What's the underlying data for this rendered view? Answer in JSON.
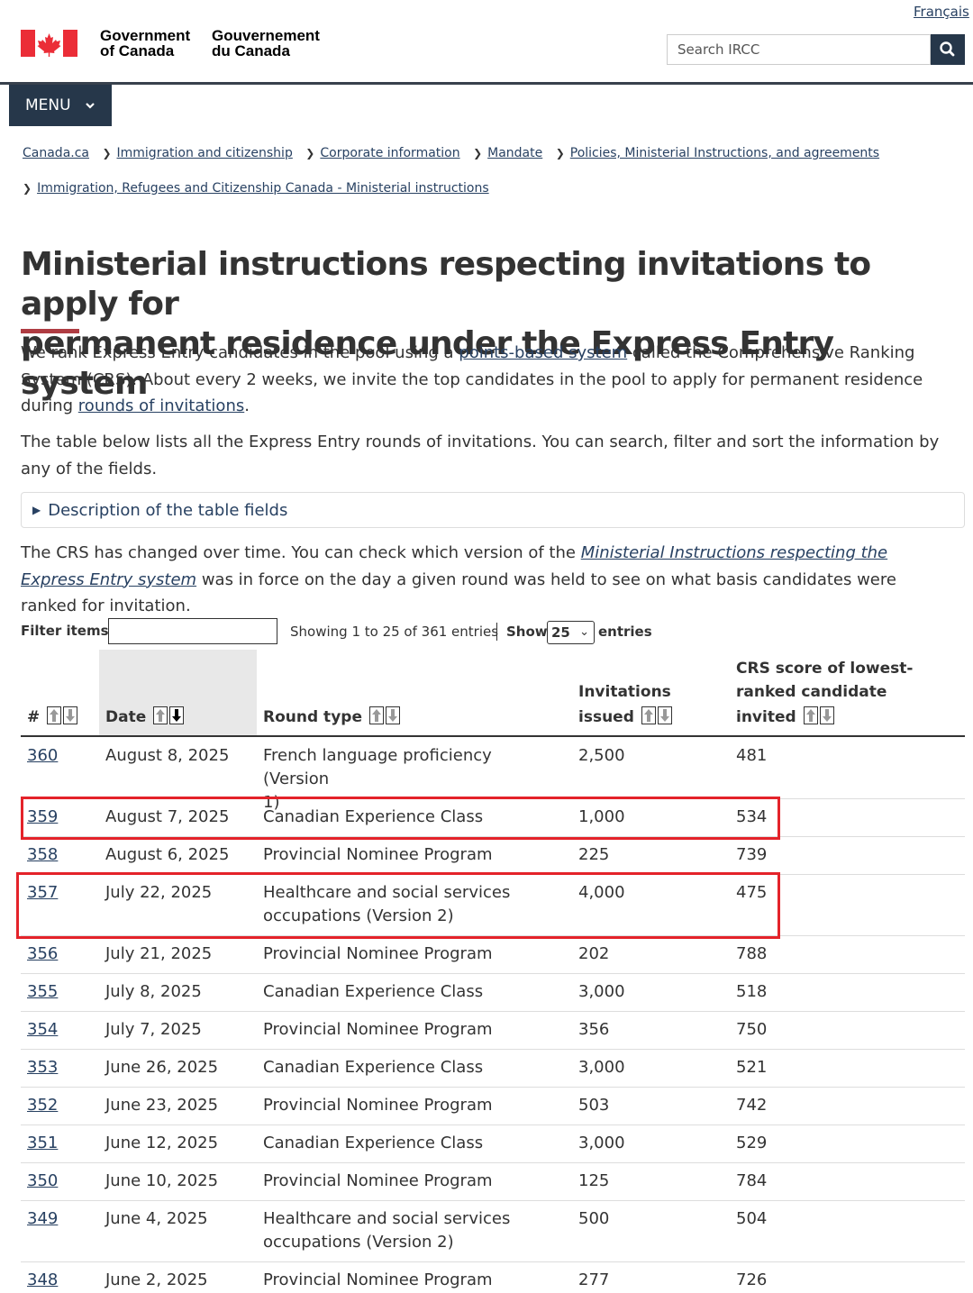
{
  "header": {
    "lang_link": "Français",
    "gov_en": [
      "Government",
      "of Canada"
    ],
    "gov_fr": [
      "Gouvernement",
      "du Canada"
    ],
    "search_placeholder": "Search IRCC",
    "menu_label": "MENU"
  },
  "breadcrumb": [
    "Canada.ca",
    "Immigration and citizenship",
    "Corporate information",
    "Mandate",
    "Policies, Ministerial Instructions, and agreements",
    "Immigration, Refugees and Citizenship Canada - Ministerial instructions"
  ],
  "title_lines": [
    "Ministerial instructions respecting invitations to apply for",
    "permanent residence under the Express Entry system"
  ],
  "intro": {
    "p1_a": "We rank Express Entry candidates in the pool using a ",
    "p1_link1": "points-based system",
    "p1_b": " called the Comprehensive Ranking System (CRS). About every 2 weeks, we invite the top candidates in the pool to apply for permanent residence during ",
    "p1_link2": "rounds of invitations",
    "p1_c": ".",
    "p2": "The table below lists all the Express Entry rounds of invitations. You can search, filter and sort the information by any of the fields.",
    "details_label": "Description of the table fields",
    "p3_a": "The CRS has changed over time. You can check which version of the ",
    "p3_link": "Ministerial Instructions respecting the Express Entry system",
    "p3_b": " was in force on the day a given round was held to see on what basis candidates were ranked for invitation."
  },
  "filter": {
    "label": "Filter items",
    "value": "",
    "showing": "Showing 1 to 25 of 361 entries",
    "show_label": "Show",
    "show_value": "25",
    "entries_label": "entries"
  },
  "table": {
    "headers": {
      "num": "#",
      "date": "Date",
      "round_type": "Round type",
      "invitations": [
        "Invitations",
        "issued"
      ],
      "crs": [
        "CRS score of lowest-",
        "ranked candidate",
        "invited"
      ]
    },
    "sorted_column": "Date",
    "sort_direction": "descending",
    "rows": [
      {
        "num": "360",
        "date": "August 8, 2025",
        "type": [
          "French language proficiency (Version",
          "1)"
        ],
        "invitations": "2,500",
        "crs": "481"
      },
      {
        "num": "359",
        "date": "August 7, 2025",
        "type": [
          "Canadian Experience Class"
        ],
        "invitations": "1,000",
        "crs": "534",
        "highlighted": true
      },
      {
        "num": "358",
        "date": "August 6, 2025",
        "type": [
          "Provincial Nominee Program"
        ],
        "invitations": "225",
        "crs": "739"
      },
      {
        "num": "357",
        "date": "July 22, 2025",
        "type": [
          "Healthcare and social services",
          "occupations (Version 2)"
        ],
        "invitations": "4,000",
        "crs": "475",
        "highlighted": true
      },
      {
        "num": "356",
        "date": "July 21, 2025",
        "type": [
          "Provincial Nominee Program"
        ],
        "invitations": "202",
        "crs": "788"
      },
      {
        "num": "355",
        "date": "July 8, 2025",
        "type": [
          "Canadian Experience Class"
        ],
        "invitations": "3,000",
        "crs": "518"
      },
      {
        "num": "354",
        "date": "July 7, 2025",
        "type": [
          "Provincial Nominee Program"
        ],
        "invitations": "356",
        "crs": "750"
      },
      {
        "num": "353",
        "date": "June 26, 2025",
        "type": [
          "Canadian Experience Class"
        ],
        "invitations": "3,000",
        "crs": "521"
      },
      {
        "num": "352",
        "date": "June 23, 2025",
        "type": [
          "Provincial Nominee Program"
        ],
        "invitations": "503",
        "crs": "742"
      },
      {
        "num": "351",
        "date": "June 12, 2025",
        "type": [
          "Canadian Experience Class"
        ],
        "invitations": "3,000",
        "crs": "529"
      },
      {
        "num": "350",
        "date": "June 10, 2025",
        "type": [
          "Provincial Nominee Program"
        ],
        "invitations": "125",
        "crs": "784"
      },
      {
        "num": "349",
        "date": "June 4, 2025",
        "type": [
          "Healthcare and social services",
          "occupations (Version 2)"
        ],
        "invitations": "500",
        "crs": "504"
      },
      {
        "num": "348",
        "date": "June 2, 2025",
        "type": [
          "Provincial Nominee Program"
        ],
        "invitations": "277",
        "crs": "726"
      }
    ]
  },
  "colors": {
    "brand_red": "#af3c43",
    "flag_red": "#eb2d37",
    "header_navy": "#26374a",
    "link": "#284162",
    "highlight_red": "#e4232a"
  }
}
